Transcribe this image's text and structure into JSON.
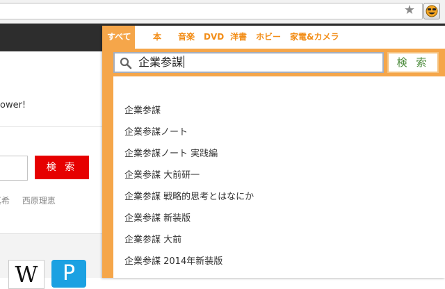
{
  "browser": {
    "star_icon": "★",
    "extension_icon": "amazon-smile-extension-icon"
  },
  "background_page": {
    "tagline": "ower!",
    "search_button": "検 索",
    "names": [
      "真希",
      "西原理恵"
    ],
    "wikipedia_letter": "W",
    "p_letter": "P"
  },
  "popup": {
    "tabs": [
      "すべて",
      "本",
      "音楽",
      "DVD",
      "洋書",
      "ホビー",
      "家電&カメラ"
    ],
    "active_tab": "すべて",
    "search": {
      "value": "企業参謀",
      "button_label": "検 索"
    },
    "suggestions": [
      "企業参謀",
      "企業参謀ノート",
      "企業参謀ノート 実践編",
      "企業参謀 大前研一",
      "企業参謀 戦略的思考とはなにか",
      "企業参謀 新装版",
      "企業参謀 大前",
      "企業参謀 2014年新装版"
    ],
    "colors": {
      "accent": "#f5a64a",
      "tab_text": "#f28d17",
      "button_text": "#4a8a3a"
    }
  }
}
